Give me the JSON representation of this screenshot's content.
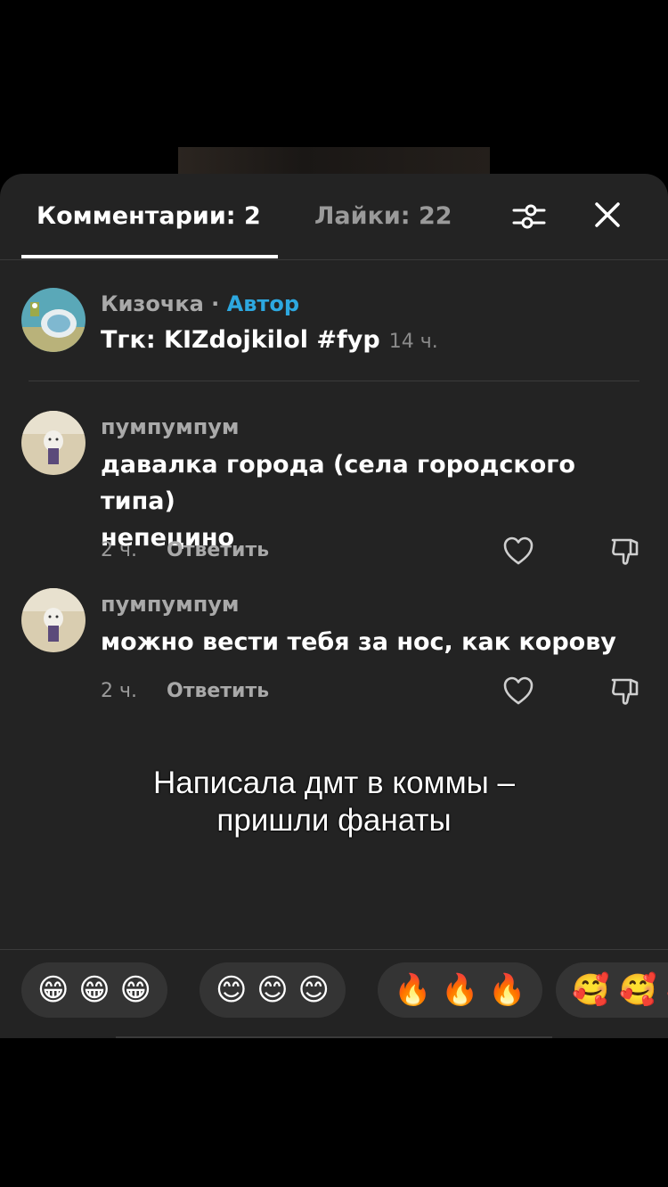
{
  "tabs": {
    "comments": "Комментарии: 2",
    "likes": "Лайки: 22"
  },
  "icons": {
    "filter": "filter-sliders-icon",
    "close": "close-icon",
    "like": "heart-icon",
    "dislike": "thumbs-down-icon"
  },
  "author_comment": {
    "name": "Кизочка",
    "separator": " · ",
    "badge": "Автор",
    "text": "Тгк: KIZdojkilol #fyp",
    "time": "14 ч."
  },
  "comments": [
    {
      "name": "пумпумпум",
      "line1": "давалка города (села городского типа)",
      "line2": "непецино",
      "time": "2 ч.",
      "reply": "Ответить"
    },
    {
      "name": "пумпумпум",
      "line1": "можно вести тебя за нос, как корову",
      "time": "2 ч.",
      "reply": "Ответить"
    }
  ],
  "caption": {
    "line1": "Написала дмт в коммы  –",
    "line2": "пришли фанаты"
  },
  "reactions": [
    "😁 😁 😁",
    "😊 😊 😊",
    "🔥 🔥 🔥",
    "🥰 🥰 🥰"
  ],
  "colors": {
    "sheet": "#232323",
    "author_badge": "#2da8e0",
    "background": "#000000"
  }
}
